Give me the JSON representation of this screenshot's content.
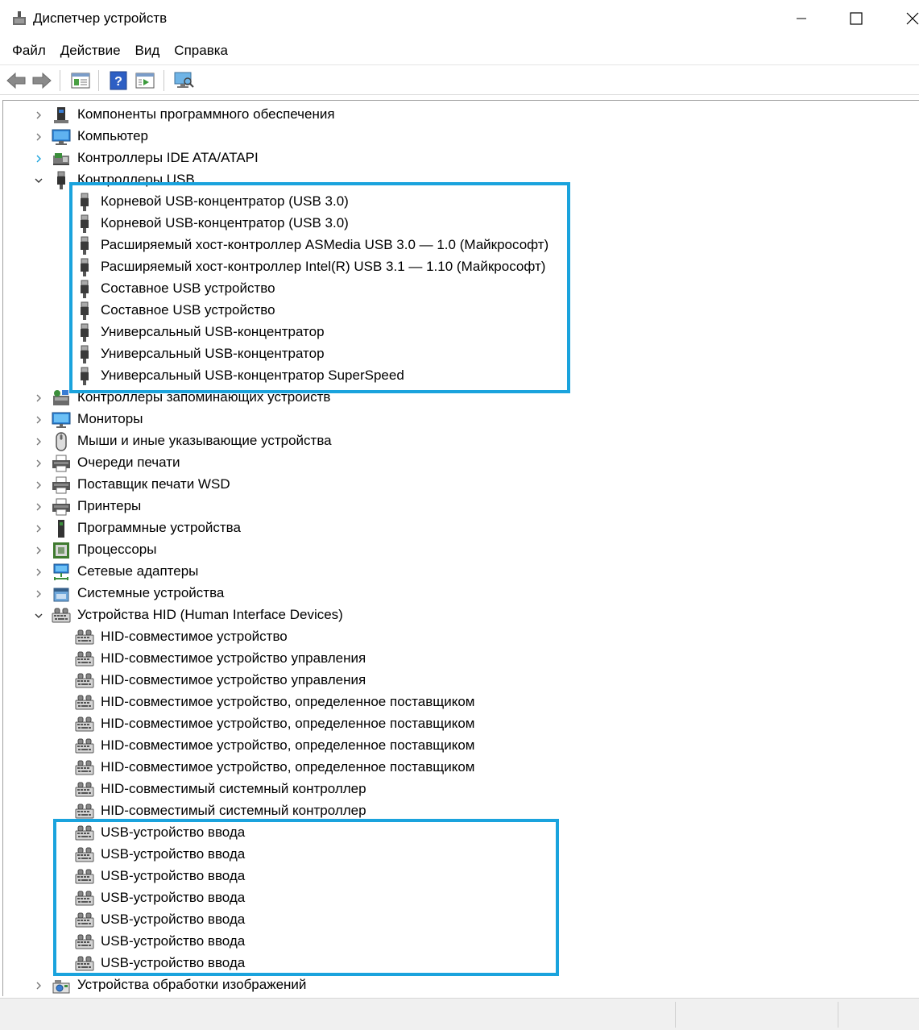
{
  "window": {
    "title": "Диспетчер устройств"
  },
  "menu": [
    "Файл",
    "Действие",
    "Вид",
    "Справка"
  ],
  "toolbar": {
    "buttons": [
      "back-icon",
      "forward-icon",
      "properties-icon",
      "help-icon",
      "update-driver-icon",
      "scan-hardware-icon"
    ]
  },
  "tree": {
    "items": [
      {
        "level": 0,
        "state": "collapsed",
        "icon": "software-component-icon",
        "label": "Компоненты программного обеспечения"
      },
      {
        "level": 0,
        "state": "collapsed",
        "icon": "computer-icon",
        "label": "Компьютер"
      },
      {
        "level": 0,
        "state": "collapsed",
        "icon": "ide-controller-icon",
        "label": "Контроллеры IDE ATA/ATAPI"
      },
      {
        "level": 0,
        "state": "expanded",
        "icon": "usb-controller-icon",
        "label": "Контроллеры USB"
      },
      {
        "level": 1,
        "icon": "usb-plug-icon",
        "label": "Корневой USB-концентратор (USB 3.0)"
      },
      {
        "level": 1,
        "icon": "usb-plug-icon",
        "label": "Корневой USB-концентратор (USB 3.0)"
      },
      {
        "level": 1,
        "icon": "usb-plug-icon",
        "label": "Расширяемый хост-контроллер ASMedia USB 3.0 — 1.0 (Майкрософт)"
      },
      {
        "level": 1,
        "icon": "usb-plug-icon",
        "label": "Расширяемый хост-контроллер Intel(R) USB 3.1 — 1.10 (Майкрософт)"
      },
      {
        "level": 1,
        "icon": "usb-plug-icon",
        "label": "Составное USB устройство"
      },
      {
        "level": 1,
        "icon": "usb-plug-icon",
        "label": "Составное USB устройство"
      },
      {
        "level": 1,
        "icon": "usb-plug-icon",
        "label": "Универсальный USB-концентратор"
      },
      {
        "level": 1,
        "icon": "usb-plug-icon",
        "label": "Универсальный USB-концентратор"
      },
      {
        "level": 1,
        "icon": "usb-plug-icon",
        "label": "Универсальный USB-концентратор SuperSpeed"
      },
      {
        "level": 0,
        "state": "collapsed",
        "icon": "storage-controller-icon",
        "label": "Контроллеры запоминающих устройств"
      },
      {
        "level": 0,
        "state": "collapsed",
        "icon": "monitor-icon",
        "label": "Мониторы"
      },
      {
        "level": 0,
        "state": "collapsed",
        "icon": "mouse-icon",
        "label": "Мыши и иные указывающие устройства"
      },
      {
        "level": 0,
        "state": "collapsed",
        "icon": "printer-icon",
        "label": "Очереди печати"
      },
      {
        "level": 0,
        "state": "collapsed",
        "icon": "printer-icon",
        "label": "Поставщик печати WSD"
      },
      {
        "level": 0,
        "state": "collapsed",
        "icon": "printer-icon",
        "label": "Принтеры"
      },
      {
        "level": 0,
        "state": "collapsed",
        "icon": "software-device-icon",
        "label": "Программные устройства"
      },
      {
        "level": 0,
        "state": "collapsed",
        "icon": "processor-icon",
        "label": "Процессоры"
      },
      {
        "level": 0,
        "state": "collapsed",
        "icon": "network-adapter-icon",
        "label": "Сетевые адаптеры"
      },
      {
        "level": 0,
        "state": "collapsed",
        "icon": "system-device-icon",
        "label": "Системные устройства"
      },
      {
        "level": 0,
        "state": "expanded",
        "icon": "hid-icon",
        "label": "Устройства HID (Human Interface Devices)"
      },
      {
        "level": 1,
        "icon": "hid-icon",
        "label": "HID-совместимое устройство"
      },
      {
        "level": 1,
        "icon": "hid-icon",
        "label": "HID-совместимое устройство управления"
      },
      {
        "level": 1,
        "icon": "hid-icon",
        "label": "HID-совместимое устройство управления"
      },
      {
        "level": 1,
        "icon": "hid-icon",
        "label": "HID-совместимое устройство, определенное поставщиком"
      },
      {
        "level": 1,
        "icon": "hid-icon",
        "label": "HID-совместимое устройство, определенное поставщиком"
      },
      {
        "level": 1,
        "icon": "hid-icon",
        "label": "HID-совместимое устройство, определенное поставщиком"
      },
      {
        "level": 1,
        "icon": "hid-icon",
        "label": "HID-совместимое устройство, определенное поставщиком"
      },
      {
        "level": 1,
        "icon": "hid-icon",
        "label": "HID-совместимый системный контроллер"
      },
      {
        "level": 1,
        "icon": "hid-icon",
        "label": "HID-совместимый системный контроллер"
      },
      {
        "level": 1,
        "icon": "hid-icon",
        "label": "USB-устройство ввода"
      },
      {
        "level": 1,
        "icon": "hid-icon",
        "label": "USB-устройство ввода"
      },
      {
        "level": 1,
        "icon": "hid-icon",
        "label": "USB-устройство ввода"
      },
      {
        "level": 1,
        "icon": "hid-icon",
        "label": "USB-устройство ввода"
      },
      {
        "level": 1,
        "icon": "hid-icon",
        "label": "USB-устройство ввода"
      },
      {
        "level": 1,
        "icon": "hid-icon",
        "label": "USB-устройство ввода"
      },
      {
        "level": 1,
        "icon": "hid-icon",
        "label": "USB-устройство ввода"
      },
      {
        "level": 0,
        "state": "collapsed",
        "icon": "imaging-device-icon",
        "label": "Устройства обработки изображений"
      }
    ]
  },
  "highlight": {
    "color": "#1aa3dd"
  }
}
